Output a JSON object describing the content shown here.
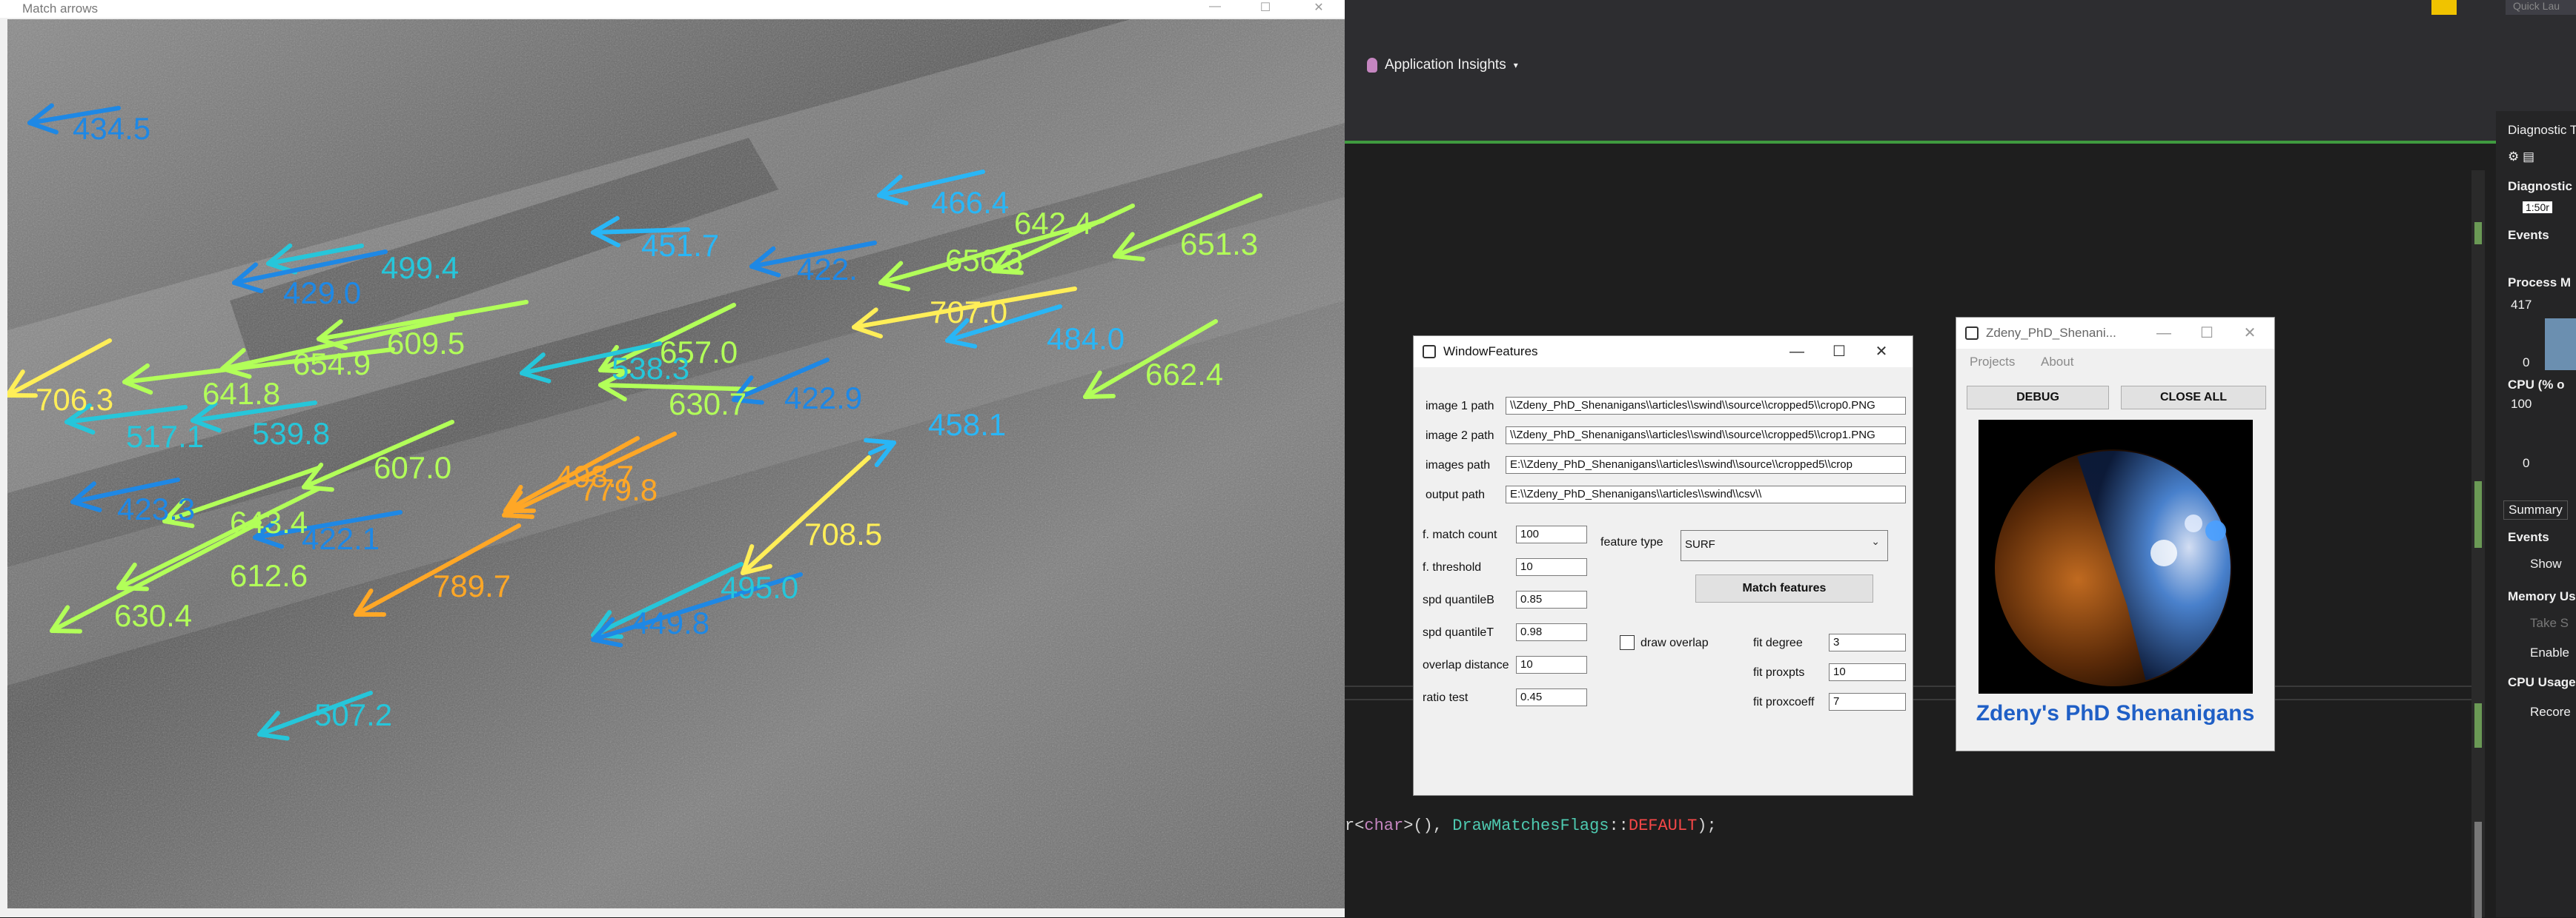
{
  "match_window": {
    "title": "Match arrows",
    "minimize": "—",
    "maximize": "☐",
    "close": "✕",
    "labels": [
      {
        "text": "434.5",
        "color": "#1e88e5"
      },
      {
        "text": "466.4",
        "color": "#29b6f6"
      },
      {
        "text": "642.4",
        "color": "#b2ff59"
      },
      {
        "text": "651.3",
        "color": "#b2ff59"
      },
      {
        "text": "499.4",
        "color": "#26c6da"
      },
      {
        "text": "451.7",
        "color": "#29b6f6"
      },
      {
        "text": "422.",
        "color": "#1e88e5"
      },
      {
        "text": "656.3",
        "color": "#b2ff59"
      },
      {
        "text": "429.0",
        "color": "#1e88e5"
      },
      {
        "text": "707.0",
        "color": "#ffee58"
      },
      {
        "text": "609.5",
        "color": "#b2ff59"
      },
      {
        "text": "484.0",
        "color": "#29b6f6"
      },
      {
        "text": "654.9",
        "color": "#b2ff59"
      },
      {
        "text": "657.0",
        "color": "#b2ff59"
      },
      {
        "text": "706.3",
        "color": "#ffee58"
      },
      {
        "text": "641.8",
        "color": "#b2ff59"
      },
      {
        "text": "538.3",
        "color": "#26c6da"
      },
      {
        "text": "662.4",
        "color": "#b2ff59"
      },
      {
        "text": "630.7",
        "color": "#b2ff59"
      },
      {
        "text": "422.9",
        "color": "#1e88e5"
      },
      {
        "text": "517.1",
        "color": "#26c6da"
      },
      {
        "text": "539.8",
        "color": "#26c6da"
      },
      {
        "text": "458.1",
        "color": "#29b6f6"
      },
      {
        "text": "607.0",
        "color": "#b2ff59"
      },
      {
        "text": "498.7",
        "color": "#ffa726"
      },
      {
        "text": "779.8",
        "color": "#ffa726"
      },
      {
        "text": "423.3",
        "color": "#1e88e5"
      },
      {
        "text": "643.4",
        "color": "#b2ff59"
      },
      {
        "text": "422.1",
        "color": "#1e88e5"
      },
      {
        "text": "708.5",
        "color": "#ffee58"
      },
      {
        "text": "612.6",
        "color": "#b2ff59"
      },
      {
        "text": "789.7",
        "color": "#ffa726"
      },
      {
        "text": "495.0",
        "color": "#26c6da"
      },
      {
        "text": "630.4",
        "color": "#b2ff59"
      },
      {
        "text": "449.8",
        "color": "#1e88e5"
      },
      {
        "text": "507.2",
        "color": "#26c6da"
      }
    ]
  },
  "ide": {
    "app_insights": "Application Insights",
    "quick_launch": "Quick Lau",
    "code": {
      "p1": "r<",
      "p2": "char",
      "p3": ">(), ",
      "p4": "DrawMatchesFlags",
      "p5": "::",
      "p6": "DEFAULT",
      "p7": ");"
    },
    "diag": {
      "title": "Diagnostic T",
      "section": "Diagnostic",
      "time": "1:50r",
      "events": "Events",
      "process": "Process M",
      "v417": "417",
      "v0a": "0",
      "cpu": "CPU (% o",
      "v100": "100",
      "v0b": "0",
      "summary": "Summary",
      "events2": "Events",
      "show": "Show",
      "memory": "Memory Us",
      "take": "Take S",
      "enable": "Enable",
      "cpu_usage": "CPU Usage",
      "record": "Recore"
    }
  },
  "features_window": {
    "title": "WindowFeatures",
    "image1_label": "image 1 path",
    "image1_value": "\\\\Zdeny_PhD_Shenanigans\\\\articles\\\\swind\\\\source\\\\cropped5\\\\crop0.PNG",
    "image2_label": "image 2 path",
    "image2_value": "\\\\Zdeny_PhD_Shenanigans\\\\articles\\\\swind\\\\source\\\\cropped5\\\\crop1.PNG",
    "images_label": "images path",
    "images_value": "E:\\\\Zdeny_PhD_Shenanigans\\\\articles\\\\swind\\\\source\\\\cropped5\\\\crop",
    "output_label": "output path",
    "output_value": "E:\\\\Zdeny_PhD_Shenanigans\\\\articles\\\\swind\\\\csv\\\\",
    "match_count_label": "f. match count",
    "match_count": "100",
    "threshold_label": "f. threshold",
    "threshold": "10",
    "quantileB_label": "spd quantileB",
    "quantileB": "0.85",
    "quantileT_label": "spd quantileT",
    "quantileT": "0.98",
    "overlap_label": "overlap distance",
    "overlap": "10",
    "ratio_label": "ratio test",
    "ratio": "0.45",
    "feature_type_label": "feature type",
    "feature_type": "SURF",
    "match_button": "Match features",
    "draw_overlap_label": "draw overlap",
    "fit_degree_label": "fit degree",
    "fit_degree": "3",
    "fit_proxpts_label": "fit proxpts",
    "fit_proxpts": "10",
    "fit_proxcoeff_label": "fit proxcoeff",
    "fit_proxcoeff": "7"
  },
  "zdeny_window": {
    "title": "Zdeny_PhD_Shenani...",
    "menu_projects": "Projects",
    "menu_about": "About",
    "debug_button": "DEBUG",
    "close_all_button": "CLOSE ALL",
    "caption": "Zdeny's PhD Shenanigans"
  }
}
